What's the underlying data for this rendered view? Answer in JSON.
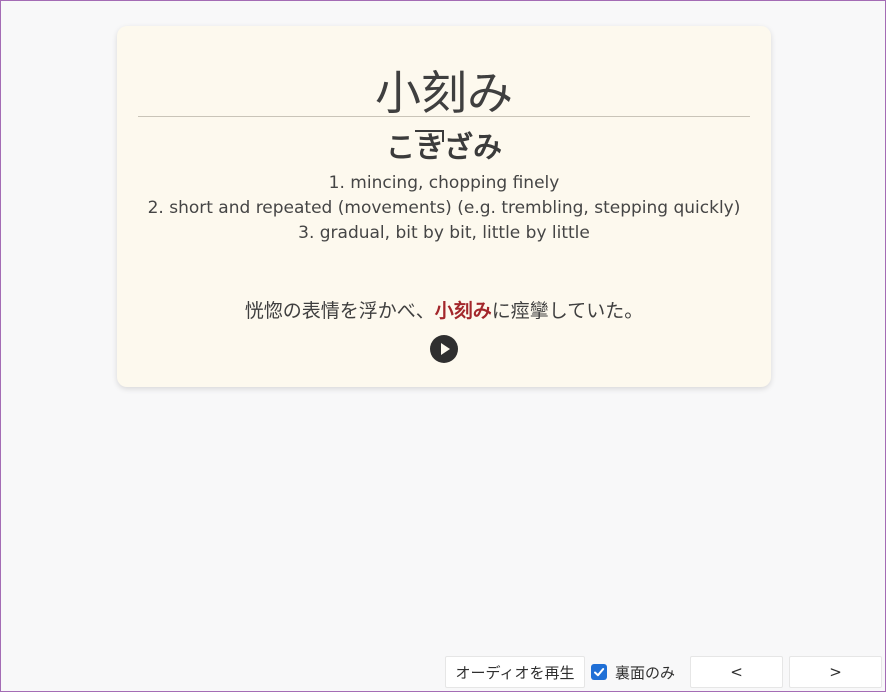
{
  "card": {
    "word": "小刻み",
    "reading": {
      "morae": [
        "こ",
        "き",
        "ざ",
        "み"
      ]
    },
    "definitions": [
      "1. mincing, chopping finely",
      "2. short and repeated (movements) (e.g. trembling, stepping quickly)",
      "3. gradual, bit by bit, little by little"
    ],
    "sentence": {
      "before": "恍惚の表情を浮かべ、",
      "highlight": "小刻み",
      "after": "に痙攣していた。"
    },
    "play_icon": "play-circle-icon"
  },
  "toolbar": {
    "audio_label": "オーディオを再生",
    "back_only_label": "裏面のみ",
    "back_only_checked": true,
    "prev_label": "<",
    "next_label": ">"
  },
  "colors": {
    "card_background": "#fdf9ee",
    "highlight": "#a3272b",
    "checkbox_accent": "#1f6fd6"
  }
}
